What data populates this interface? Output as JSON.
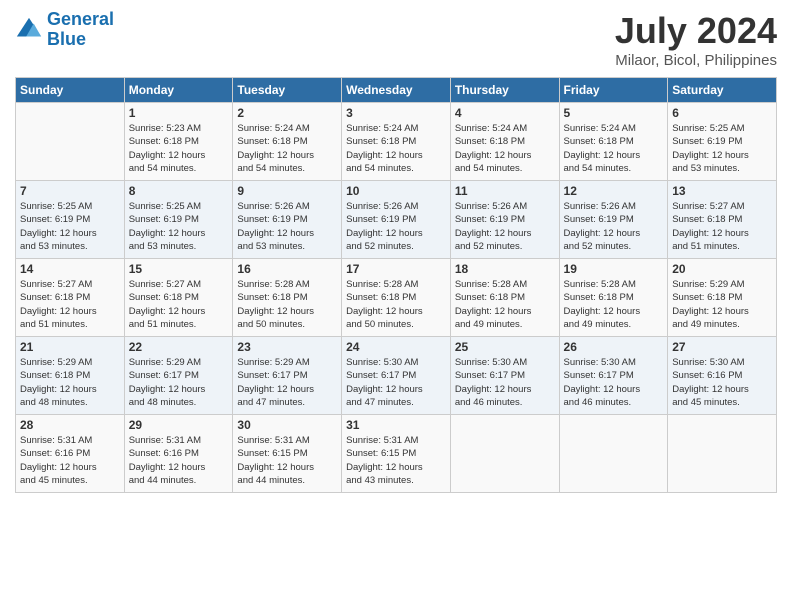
{
  "header": {
    "logo_line1": "General",
    "logo_line2": "Blue",
    "month_year": "July 2024",
    "location": "Milaor, Bicol, Philippines"
  },
  "days_of_week": [
    "Sunday",
    "Monday",
    "Tuesday",
    "Wednesday",
    "Thursday",
    "Friday",
    "Saturday"
  ],
  "weeks": [
    [
      {
        "day": "",
        "content": ""
      },
      {
        "day": "1",
        "content": "Sunrise: 5:23 AM\nSunset: 6:18 PM\nDaylight: 12 hours\nand 54 minutes."
      },
      {
        "day": "2",
        "content": "Sunrise: 5:24 AM\nSunset: 6:18 PM\nDaylight: 12 hours\nand 54 minutes."
      },
      {
        "day": "3",
        "content": "Sunrise: 5:24 AM\nSunset: 6:18 PM\nDaylight: 12 hours\nand 54 minutes."
      },
      {
        "day": "4",
        "content": "Sunrise: 5:24 AM\nSunset: 6:18 PM\nDaylight: 12 hours\nand 54 minutes."
      },
      {
        "day": "5",
        "content": "Sunrise: 5:24 AM\nSunset: 6:18 PM\nDaylight: 12 hours\nand 54 minutes."
      },
      {
        "day": "6",
        "content": "Sunrise: 5:25 AM\nSunset: 6:19 PM\nDaylight: 12 hours\nand 53 minutes."
      }
    ],
    [
      {
        "day": "7",
        "content": "Sunrise: 5:25 AM\nSunset: 6:19 PM\nDaylight: 12 hours\nand 53 minutes."
      },
      {
        "day": "8",
        "content": "Sunrise: 5:25 AM\nSunset: 6:19 PM\nDaylight: 12 hours\nand 53 minutes."
      },
      {
        "day": "9",
        "content": "Sunrise: 5:26 AM\nSunset: 6:19 PM\nDaylight: 12 hours\nand 53 minutes."
      },
      {
        "day": "10",
        "content": "Sunrise: 5:26 AM\nSunset: 6:19 PM\nDaylight: 12 hours\nand 52 minutes."
      },
      {
        "day": "11",
        "content": "Sunrise: 5:26 AM\nSunset: 6:19 PM\nDaylight: 12 hours\nand 52 minutes."
      },
      {
        "day": "12",
        "content": "Sunrise: 5:26 AM\nSunset: 6:19 PM\nDaylight: 12 hours\nand 52 minutes."
      },
      {
        "day": "13",
        "content": "Sunrise: 5:27 AM\nSunset: 6:18 PM\nDaylight: 12 hours\nand 51 minutes."
      }
    ],
    [
      {
        "day": "14",
        "content": "Sunrise: 5:27 AM\nSunset: 6:18 PM\nDaylight: 12 hours\nand 51 minutes."
      },
      {
        "day": "15",
        "content": "Sunrise: 5:27 AM\nSunset: 6:18 PM\nDaylight: 12 hours\nand 51 minutes."
      },
      {
        "day": "16",
        "content": "Sunrise: 5:28 AM\nSunset: 6:18 PM\nDaylight: 12 hours\nand 50 minutes."
      },
      {
        "day": "17",
        "content": "Sunrise: 5:28 AM\nSunset: 6:18 PM\nDaylight: 12 hours\nand 50 minutes."
      },
      {
        "day": "18",
        "content": "Sunrise: 5:28 AM\nSunset: 6:18 PM\nDaylight: 12 hours\nand 49 minutes."
      },
      {
        "day": "19",
        "content": "Sunrise: 5:28 AM\nSunset: 6:18 PM\nDaylight: 12 hours\nand 49 minutes."
      },
      {
        "day": "20",
        "content": "Sunrise: 5:29 AM\nSunset: 6:18 PM\nDaylight: 12 hours\nand 49 minutes."
      }
    ],
    [
      {
        "day": "21",
        "content": "Sunrise: 5:29 AM\nSunset: 6:18 PM\nDaylight: 12 hours\nand 48 minutes."
      },
      {
        "day": "22",
        "content": "Sunrise: 5:29 AM\nSunset: 6:17 PM\nDaylight: 12 hours\nand 48 minutes."
      },
      {
        "day": "23",
        "content": "Sunrise: 5:29 AM\nSunset: 6:17 PM\nDaylight: 12 hours\nand 47 minutes."
      },
      {
        "day": "24",
        "content": "Sunrise: 5:30 AM\nSunset: 6:17 PM\nDaylight: 12 hours\nand 47 minutes."
      },
      {
        "day": "25",
        "content": "Sunrise: 5:30 AM\nSunset: 6:17 PM\nDaylight: 12 hours\nand 46 minutes."
      },
      {
        "day": "26",
        "content": "Sunrise: 5:30 AM\nSunset: 6:17 PM\nDaylight: 12 hours\nand 46 minutes."
      },
      {
        "day": "27",
        "content": "Sunrise: 5:30 AM\nSunset: 6:16 PM\nDaylight: 12 hours\nand 45 minutes."
      }
    ],
    [
      {
        "day": "28",
        "content": "Sunrise: 5:31 AM\nSunset: 6:16 PM\nDaylight: 12 hours\nand 45 minutes."
      },
      {
        "day": "29",
        "content": "Sunrise: 5:31 AM\nSunset: 6:16 PM\nDaylight: 12 hours\nand 44 minutes."
      },
      {
        "day": "30",
        "content": "Sunrise: 5:31 AM\nSunset: 6:15 PM\nDaylight: 12 hours\nand 44 minutes."
      },
      {
        "day": "31",
        "content": "Sunrise: 5:31 AM\nSunset: 6:15 PM\nDaylight: 12 hours\nand 43 minutes."
      },
      {
        "day": "",
        "content": ""
      },
      {
        "day": "",
        "content": ""
      },
      {
        "day": "",
        "content": ""
      }
    ]
  ]
}
